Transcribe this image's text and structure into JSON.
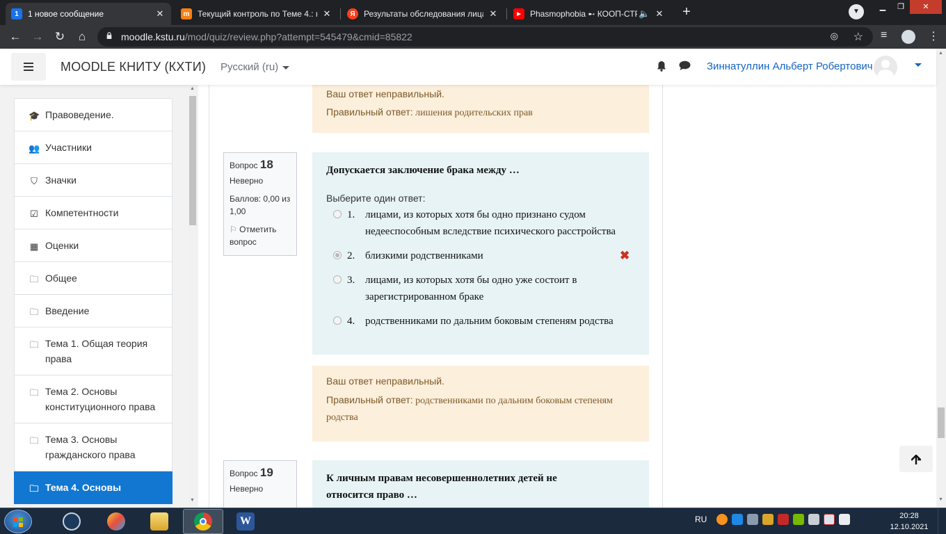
{
  "browser": {
    "tabs": [
      {
        "title": "1 новое сообщение",
        "favicon_text": "1",
        "favicon_color": "#1a73e8"
      },
      {
        "title": "Текущий контроль по Теме 4.: п",
        "favicon_text": "m",
        "favicon_color": "#f98012"
      },
      {
        "title": "Результаты обследования лица,",
        "favicon_text": "Я",
        "favicon_color": "#fc3f1d"
      },
      {
        "title": "Phasmophobia ➸ КООП-СТР",
        "favicon_text": "▶",
        "favicon_color": "#ff0000"
      }
    ],
    "url_host": "moodle.kstu.ru",
    "url_path": "/mod/quiz/review.php?attempt=545479&cmid=85822"
  },
  "navbar": {
    "site_name": "MOODLE КНИТУ (КХТИ)",
    "language": "Русский ‎(ru)‎",
    "user_name": "Зиннатуллин Альберт Робертович"
  },
  "drawer": {
    "items": [
      {
        "label": "Правоведение.",
        "icon": "graduation-cap-icon",
        "glyph": "🎓"
      },
      {
        "label": "Участники",
        "icon": "users-icon",
        "glyph": "👥"
      },
      {
        "label": "Значки",
        "icon": "shield-icon",
        "glyph": "⛉"
      },
      {
        "label": "Компетентности",
        "icon": "checkbox-icon",
        "glyph": "☑"
      },
      {
        "label": "Оценки",
        "icon": "table-icon",
        "glyph": "▦"
      },
      {
        "label": "Общее",
        "icon": "folder-icon",
        "glyph": "🗀"
      },
      {
        "label": "Введение",
        "icon": "folder-icon",
        "glyph": "🗀"
      },
      {
        "label": "Тема 1. Общая теория права",
        "icon": "folder-icon",
        "glyph": "🗀"
      },
      {
        "label": "Тема 2. Основы конституционного права",
        "icon": "folder-icon",
        "glyph": "🗀"
      },
      {
        "label": "Тема 3. Основы гражданского права",
        "icon": "folder-icon",
        "glyph": "🗀"
      },
      {
        "label": "Тема 4. Основы",
        "icon": "folder-icon",
        "glyph": "🗀"
      }
    ]
  },
  "prev_feedback": {
    "verdict": "Ваш ответ неправильный.",
    "right_label": "Правильный ответ:",
    "right_answer": "лишения родительских прав"
  },
  "q18": {
    "label": "Вопрос",
    "number": "18",
    "status": "Неверно",
    "score": "Баллов: 0,00 из 1,00",
    "flag": "Отметить вопрос",
    "text": "Допускается заключение брака между …",
    "prompt": "Выберите один ответ:",
    "answers": [
      {
        "num": "1.",
        "text": "лицами, из которых хотя бы одно признано судом недееспособным вследствие психического расстройства",
        "selected": false
      },
      {
        "num": "2.",
        "text": "близкими родственниками",
        "selected": true
      },
      {
        "num": "3.",
        "text": "лицами, из которых хотя бы одно уже состоит в зарегистрированном браке",
        "selected": false
      },
      {
        "num": "4.",
        "text": "родственниками по дальним боковым степеням родства",
        "selected": false
      }
    ],
    "wrong_mark": "✖",
    "feedback": {
      "verdict": "Ваш ответ неправильный.",
      "right_label": "Правильный ответ:",
      "right_answer": "родственниками по дальним боковым степеням родства"
    }
  },
  "q19": {
    "label": "Вопрос",
    "number": "19",
    "status": "Неверно",
    "text": "К личным правам несовершеннолетних детей не относится право …"
  },
  "taskbar": {
    "language": "RU",
    "time": "20:28",
    "date": "12.10.2021"
  }
}
